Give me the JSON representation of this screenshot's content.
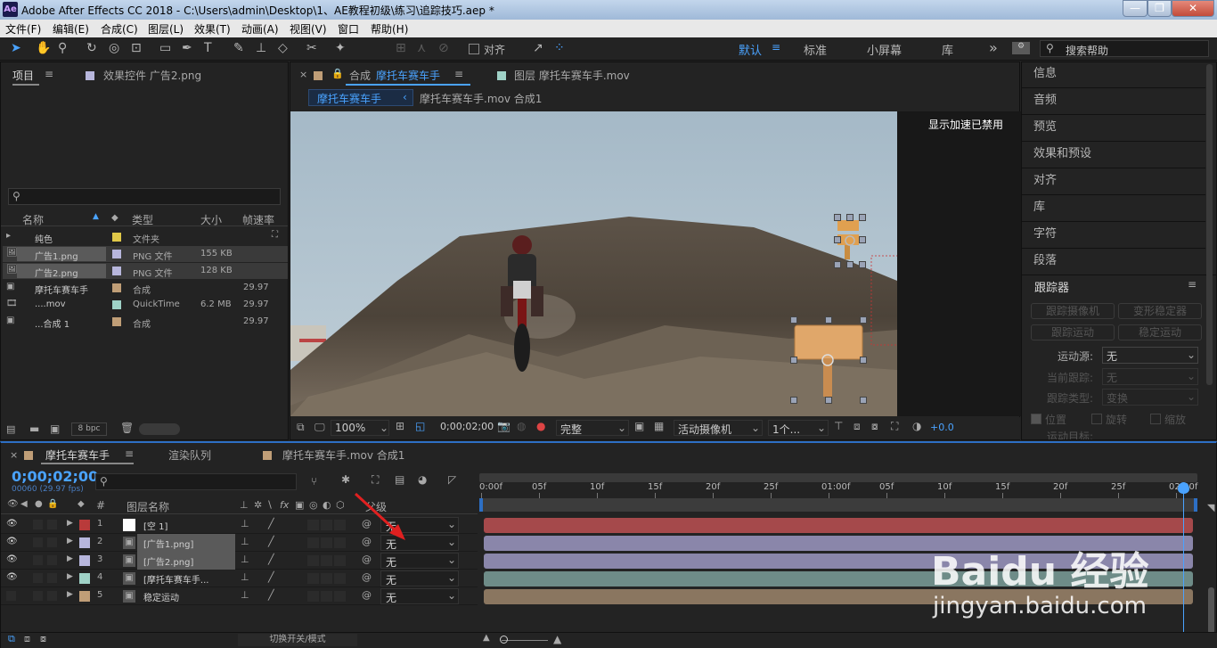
{
  "window": {
    "app_badge": "Ae",
    "title": "Adobe After Effects CC 2018 - C:\\Users\\admin\\Desktop\\1、AE教程初级\\练习\\追踪技巧.aep *",
    "minimize": "—",
    "maximize": "❐",
    "close": "✕"
  },
  "menu": [
    "文件(F)",
    "编辑(E)",
    "合成(C)",
    "图层(L)",
    "效果(T)",
    "动画(A)",
    "视图(V)",
    "窗口",
    "帮助(H)"
  ],
  "toolbar": {
    "align_label": "对齐",
    "workspaces": [
      "默认",
      "标准",
      "小屏幕",
      "库"
    ],
    "more": "»",
    "search_placeholder": "搜索帮助"
  },
  "project": {
    "tab_project": "项目",
    "tab_effects": "效果控件 广告2.png",
    "columns": [
      "名称",
      "类型",
      "大小",
      "帧速率"
    ],
    "items": [
      {
        "name": "纯色",
        "type": "文件夹",
        "size": "",
        "fps": "",
        "color": "#e0c848"
      },
      {
        "name": "广告1.png",
        "type": "PNG 文件",
        "size": "155 KB",
        "fps": "",
        "color": "#b7b6dc"
      },
      {
        "name": "广告2.png",
        "type": "PNG 文件",
        "size": "128 KB",
        "fps": "",
        "color": "#b7b6dc"
      },
      {
        "name": "摩托车赛车手",
        "type": "合成",
        "size": "",
        "fps": "29.97",
        "color": "#c09e77"
      },
      {
        "name": "....mov",
        "type": "QuickTime",
        "size": "6.2 MB",
        "fps": "29.97",
        "color": "#9fd2c7"
      },
      {
        "name": "...合成 1",
        "type": "合成",
        "size": "",
        "fps": "29.97",
        "color": "#c09e77"
      }
    ],
    "bpc": "8 bpc"
  },
  "comp": {
    "tab_prefix": "合成",
    "tab_name": "摩托车赛车手",
    "tab_layer": "图层 摩托车赛车手.mov",
    "breadcrumb_active": "摩托车赛车手",
    "breadcrumb_other": "摩托车赛车手.mov 合成1",
    "gpu_notice": "显示加速已禁用",
    "zoom": "100%",
    "timecode": "0;00;02;00",
    "resolution": "完整",
    "camera": "活动摄像机",
    "views": "1个...",
    "exposure": "+0.0"
  },
  "right_panels": [
    "信息",
    "音频",
    "预览",
    "效果和预设",
    "对齐",
    "库",
    "字符",
    "段落"
  ],
  "tracker": {
    "title": "跟踪器",
    "btn_track_camera": "跟踪摄像机",
    "btn_warp": "变形稳定器",
    "btn_track_motion": "跟踪运动",
    "btn_stabilize": "稳定运动",
    "source_label": "运动源:",
    "source_value": "无",
    "current_label": "当前跟踪:",
    "current_value": "无",
    "type_label": "跟踪类型:",
    "type_value": "变换",
    "opt_position": "位置",
    "opt_rotation": "旋转",
    "opt_scale": "缩放",
    "target_label": "运动目标:"
  },
  "timeline": {
    "tab_active": "摩托车赛车手",
    "tab_render": "渲染队列",
    "tab_other": "摩托车赛车手.mov 合成1",
    "timecode": "0;00;02;00",
    "frames": "00060 (29.97 fps)",
    "col_num": "#",
    "col_name": "图层名称",
    "col_parent": "父级",
    "ruler": [
      "0:00f",
      "05f",
      "10f",
      "15f",
      "20f",
      "25f",
      "01:00f",
      "05f",
      "10f",
      "15f",
      "20f",
      "25f",
      "02:00f"
    ],
    "toggle_label": "切换开关/模式",
    "layers": [
      {
        "num": "1",
        "name": "[空 1]",
        "parent": "无",
        "label": "#b93a3a",
        "bar": "#a5494b"
      },
      {
        "num": "2",
        "name": "[广告1.png]",
        "parent": "无",
        "label": "#b7b6dc",
        "bar": "#8a86aa"
      },
      {
        "num": "3",
        "name": "[广告2.png]",
        "parent": "无",
        "label": "#b7b6dc",
        "bar": "#8a86aa"
      },
      {
        "num": "4",
        "name": "[摩托车赛车手...",
        "parent": "无",
        "label": "#9fd2c7",
        "bar": "#6e8c88"
      },
      {
        "num": "5",
        "name": "稳定运动",
        "parent": "无",
        "label": "#c09e77",
        "bar": "#8a7660"
      }
    ]
  },
  "watermark": {
    "brand": "Baidu 经验",
    "url": "jingyan.baidu.com"
  }
}
